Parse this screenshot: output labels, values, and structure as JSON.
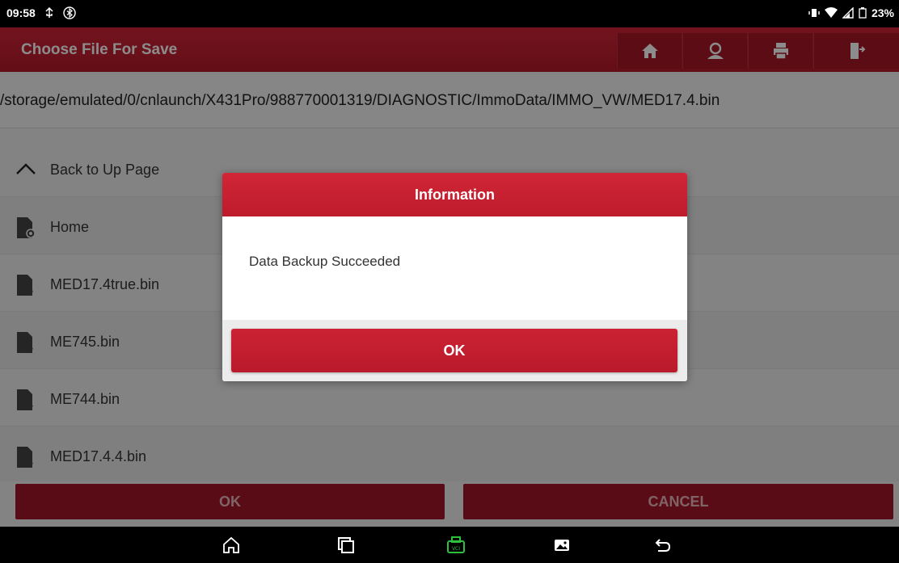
{
  "status_bar": {
    "time": "09:58",
    "battery": "23%",
    "left_icons": [
      "usb-icon",
      "bluetooth-icon"
    ],
    "right_icons": [
      "vibrate-icon",
      "wifi-icon",
      "signal-icon",
      "battery-icon"
    ]
  },
  "header": {
    "title": "Choose File For Save",
    "buttons": [
      "home-icon",
      "user-icon",
      "print-icon",
      "exit-icon"
    ]
  },
  "path": "/storage/emulated/0/cnlaunch/X431Pro/988770001319/DIAGNOSTIC/ImmoData/IMMO_VW/MED17.4.bin",
  "list": {
    "back_label": "Back to Up Page",
    "items": [
      {
        "label": "Home",
        "icon": "folder-settings-icon"
      },
      {
        "label": "MED17.4true.bin",
        "icon": "unknown-file-icon"
      },
      {
        "label": "ME745.bin",
        "icon": "unknown-file-icon"
      },
      {
        "label": "ME744.bin",
        "icon": "unknown-file-icon"
      },
      {
        "label": "MED17.4.4.bin",
        "icon": "unknown-file-icon"
      }
    ]
  },
  "bottom_buttons": {
    "ok": "OK",
    "cancel": "CANCEL"
  },
  "dialog": {
    "title": "Information",
    "message": "Data Backup Succeeded",
    "ok": "OK"
  },
  "nav_bar": [
    "home-icon",
    "recents-icon",
    "vci-icon",
    "screenshot-icon",
    "back-icon"
  ],
  "colors": {
    "brand_red": "#c41e30",
    "dark_red": "#a51728",
    "vci_green": "#2fbf3f"
  }
}
